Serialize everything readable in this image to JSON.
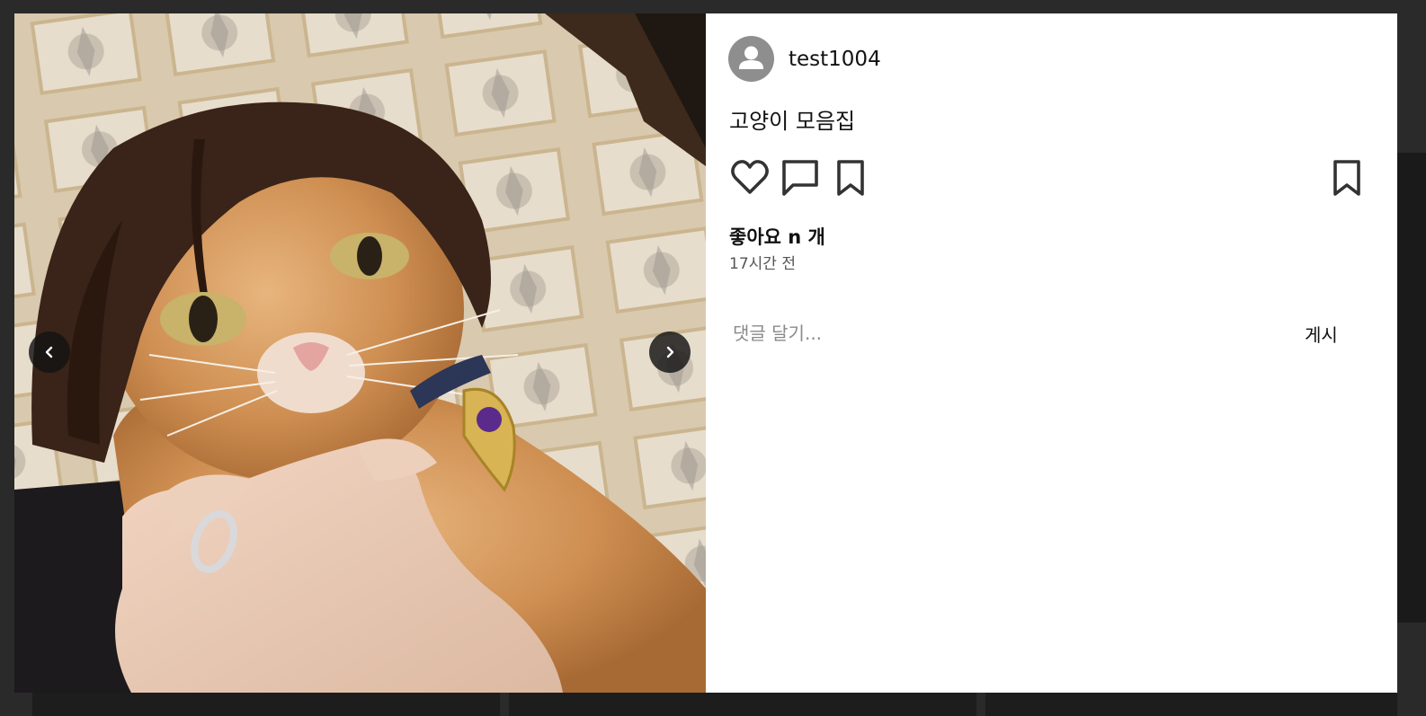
{
  "post": {
    "username": "test1004",
    "caption": "고양이 모음집",
    "likes_text": "좋아요 n 개",
    "time_text": "17시간 전"
  },
  "comment": {
    "placeholder": "댓글 달기...",
    "post_label": "게시"
  },
  "icons": {
    "avatar": "user-avatar-icon",
    "prev": "chevron-left-icon",
    "next": "chevron-right-icon",
    "like": "heart-icon",
    "comment": "comment-icon",
    "save": "bookmark-icon",
    "save_right": "bookmark-icon"
  },
  "colors": {
    "backdrop": "#2a2a2a",
    "panel": "#ffffff",
    "text": "#111111",
    "muted": "#8a8a8a",
    "avatar": "#8e8e8e",
    "nav_button": "#141414"
  }
}
